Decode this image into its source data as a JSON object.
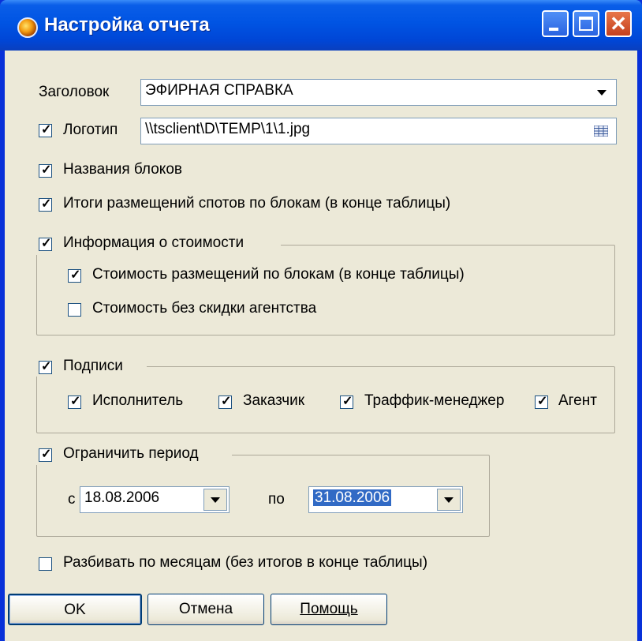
{
  "window": {
    "title": "Настройка отчета"
  },
  "header_field": {
    "label": "Заголовок",
    "value": "ЭФИРНАЯ СПРАВКА"
  },
  "logo": {
    "label": "Логотип",
    "checked": true,
    "path": "\\\\tsclient\\D\\TEMP\\1\\1.jpg"
  },
  "options": {
    "block_names": {
      "label": "Названия блоков",
      "checked": true
    },
    "spot_totals": {
      "label": "Итоги размещений спотов по блокам (в конце таблицы)",
      "checked": true
    }
  },
  "cost_info": {
    "label": "Информация о стоимости",
    "checked": true,
    "cost_by_blocks": {
      "label": "Стоимость размещений по блокам (в конце таблицы)",
      "checked": true
    },
    "cost_no_discount": {
      "label": "Стоимость без скидки агентства",
      "checked": false
    }
  },
  "signatures": {
    "label": "Подписи",
    "checked": true,
    "executor": {
      "label": "Исполнитель",
      "checked": true
    },
    "customer": {
      "label": "Заказчик",
      "checked": true
    },
    "traffic_manager": {
      "label": "Траффик-менеджер",
      "checked": true
    },
    "agent": {
      "label": "Агент",
      "checked": true
    }
  },
  "period": {
    "label": "Ограничить период",
    "checked": true,
    "from_label": "с",
    "from_value": "18.08.2006",
    "to_label": "по",
    "to_value": "31.08.2006"
  },
  "split_by_months": {
    "label": "Разбивать по месяцам (без итогов в конце таблицы)",
    "checked": false
  },
  "buttons": {
    "ok": "OK",
    "cancel": "Отмена",
    "help": "Помощь"
  },
  "colors": {
    "titlebar": "#0054e3",
    "face": "#ece9d8",
    "selection": "#316ac5"
  }
}
